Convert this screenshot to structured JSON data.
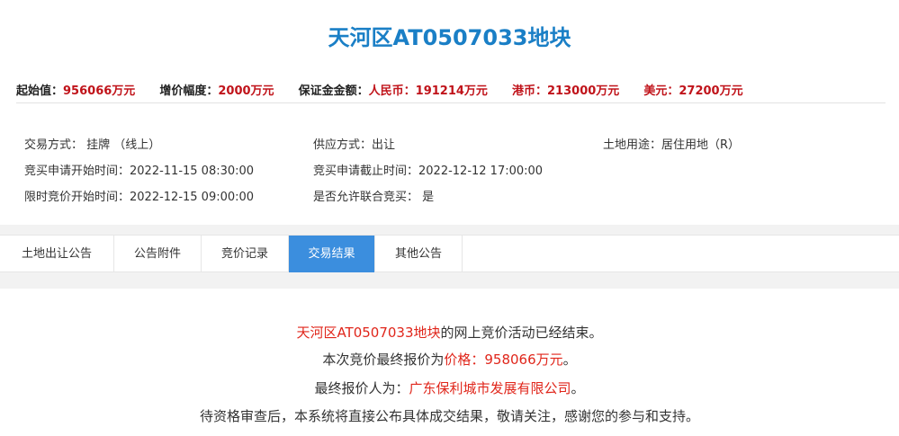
{
  "header": {
    "title": "天河区AT0507033地块"
  },
  "price_bar": {
    "start_label": "起始值：",
    "start_value": "956066万元",
    "increment_label": "增价幅度：",
    "increment_value": "2000万元",
    "deposit_label": "保证金金额：",
    "rmb_label": "人民币：",
    "rmb_value": "191214万元",
    "hkd_label": "港币：",
    "hkd_value": "213000万元",
    "usd_label": "美元：",
    "usd_value": "27200万元"
  },
  "details": {
    "trade_method": "交易方式： 挂牌 （线上）",
    "supply_method": "供应方式：出让",
    "land_use": "土地用途：居住用地（R）",
    "apply_start": "竞买申请开始时间：2022-11-15 08:30:00",
    "apply_end": "竞买申请截止时间：2022-12-12 17:00:00",
    "bid_start": "限时竞价开始时间：2022-12-15 09:00:00",
    "joint_bid": "是否允许联合竞买： 是"
  },
  "tabs": [
    {
      "label": "土地出让公告",
      "active": false
    },
    {
      "label": "公告附件",
      "active": false
    },
    {
      "label": "竞价记录",
      "active": false
    },
    {
      "label": "交易结果",
      "active": true
    },
    {
      "label": "其他公告",
      "active": false
    }
  ],
  "result": {
    "line1_red": "天河区AT0507033地块",
    "line1_rest": "的网上竞价活动已经结束。",
    "line2_prefix": "本次竞价最终报价为",
    "line2_red": "价格：958066万元",
    "line2_suffix": "。",
    "line3_prefix": "最终报价人为：",
    "line3_red": "广东保利城市发展有限公司",
    "line3_suffix": "。",
    "line4": "待资格审查后，本系统将直接公布具体成交结果，敬请关注，感谢您的参与和支持。"
  },
  "colors": {
    "title_blue": "#1a7fc6",
    "value_red": "#c0131a",
    "tab_active": "#3b8ede"
  }
}
